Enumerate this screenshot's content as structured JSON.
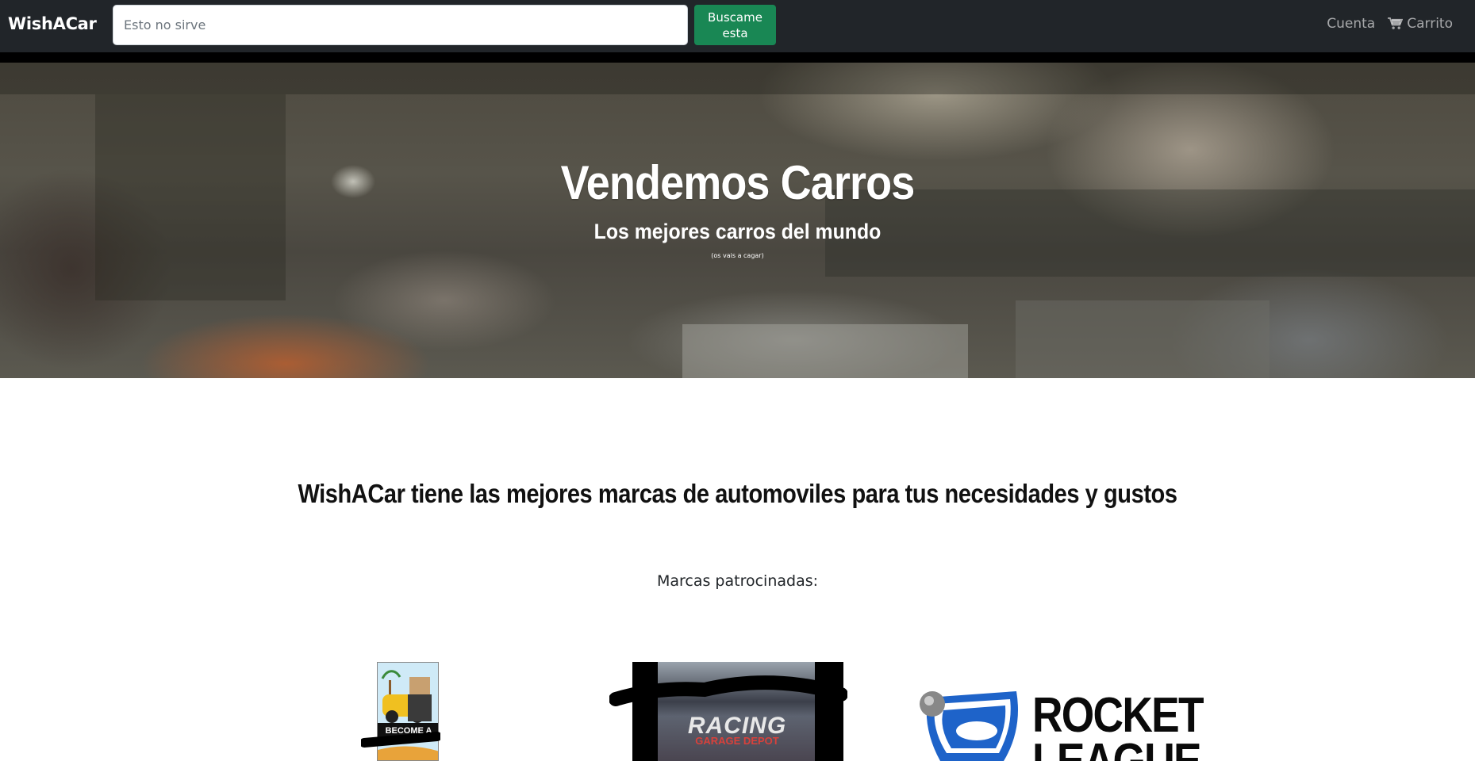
{
  "navbar": {
    "brand": "WishACar",
    "search": {
      "placeholder": "Esto no sirve",
      "value": ""
    },
    "search_button": "Buscame esta",
    "account_link": "Cuenta",
    "cart_link": "Carrito",
    "cart_icon": "shopping-cart-icon"
  },
  "hero": {
    "title": "Vendemos Carros",
    "subtitle": "Los mejores carros del mundo",
    "note": "(os vais a cagar)"
  },
  "main": {
    "heading": "WishACar tiene las mejores marcas de automoviles para tus necesidades y gustos",
    "sponsors_label": "Marcas patrocinadas:"
  },
  "sponsors": {
    "roblox_text": "BECOME A",
    "racing_text": "RACING",
    "racing_subtext": "GARAGE DEPOT",
    "rocket_text_1": "ROCKET",
    "rocket_text_2": "LEAGUE"
  },
  "colors": {
    "navbar_bg": "#212529",
    "search_button_bg": "#198754",
    "rocket_blue": "#1e63c9"
  }
}
